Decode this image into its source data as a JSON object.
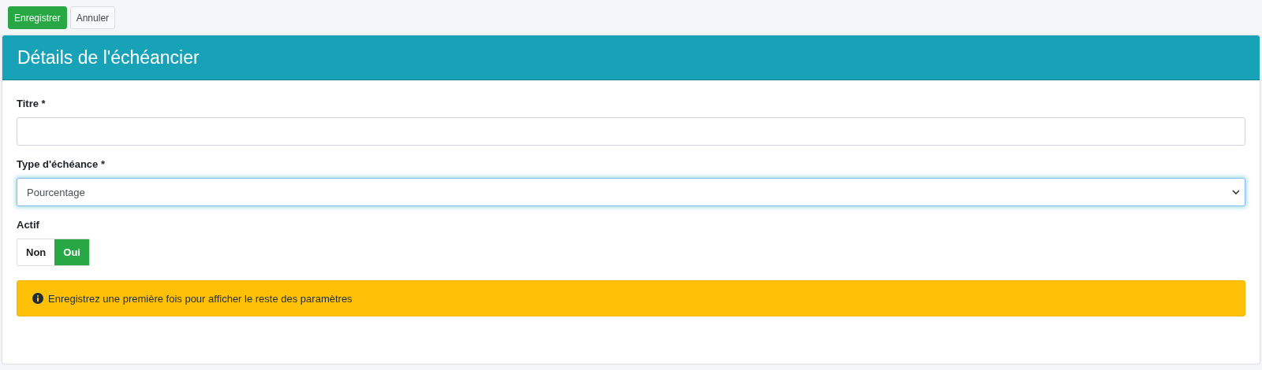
{
  "toolbar": {
    "buttons": [
      {
        "label": "Enregistrer",
        "kind": "primary"
      },
      {
        "label": "Annuler",
        "kind": "secondary"
      }
    ]
  },
  "card": {
    "title": "Détails de l'échéancier",
    "fields": [
      {
        "kind": "text",
        "label": "Titre *"
      },
      {
        "kind": "select",
        "label": "Type d'échéance *",
        "value": "Pourcentage",
        "focused": true
      },
      {
        "kind": "toggle",
        "label": "Actif",
        "options": [
          {
            "label": "Non",
            "selected": false
          },
          {
            "label": "Oui",
            "selected": true
          }
        ]
      }
    ],
    "alert": {
      "text": "Enregistrez une première fois pour afficher le reste des paramètres"
    }
  }
}
